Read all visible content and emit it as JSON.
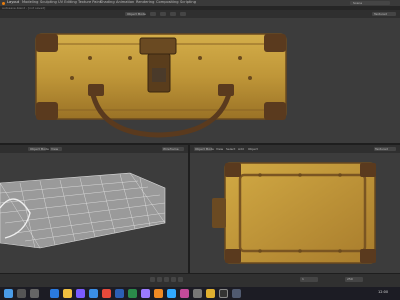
{
  "app": {
    "menu_items": [
      "Layout",
      "Modeling",
      "Sculpting",
      "UV Editing",
      "Texture Paint",
      "Shading",
      "Animation",
      "Rendering",
      "Compositing",
      "Scripting"
    ],
    "search_placeholder": "Scene",
    "status": "autosave.blend - [not saved]"
  },
  "viewports": {
    "top": {
      "view_label": "Perspective",
      "mode_label": "Object Mode",
      "shading_label": "Textured"
    },
    "bottom_left": {
      "mode_label": "Object Mode",
      "view_label": "View",
      "shading_label": "Wireframe"
    },
    "bottom_right": {
      "mode_label": "Object Mode",
      "menus": [
        "View",
        "Select",
        "Add",
        "Object"
      ],
      "shading_label": "Textured"
    }
  },
  "timeline": {
    "frame_label": "1",
    "end_label": "250"
  },
  "taskbar": {
    "icons": [
      "start",
      "search",
      "task-view",
      "edge",
      "files",
      "store",
      "mail",
      "chrome",
      "word",
      "excel",
      "premiere",
      "blender",
      "photoshop",
      "media",
      "settings",
      "explorer",
      "terminal",
      "calc"
    ],
    "colors": {
      "start": "#4a9ce8",
      "edge": "#2a7be0",
      "files": "#f0c040",
      "chrome": "#e64a3b",
      "word": "#2b5fb4",
      "excel": "#2a8a4a",
      "premiere": "#9b7bff",
      "blender": "#f08a24",
      "photoshop": "#31a8ff"
    },
    "clock": "12:00"
  },
  "colors": {
    "suitcase": "#c29a3a",
    "suitcase_dark": "#7a5522",
    "strap": "#5a3a1e",
    "wire": "#d0d0d0",
    "bg": "#3c3c3c"
  }
}
